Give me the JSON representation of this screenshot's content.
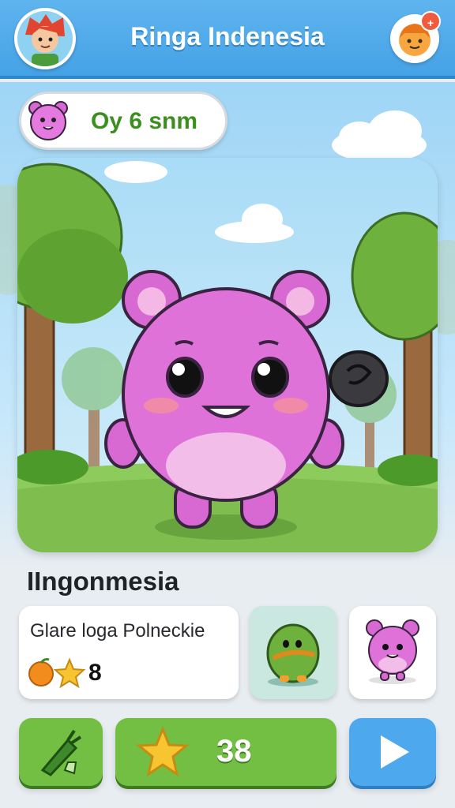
{
  "header": {
    "title": "Ringa Indenesia",
    "avatar_icon": "player-avatar-icon",
    "profile_icon": "profile-face-icon",
    "notification_badge": "+"
  },
  "speech": {
    "text": "Oy 6 snm",
    "icon": "pink-pet-icon"
  },
  "pet": {
    "name": "IIngonmesia",
    "color": "#d868d2"
  },
  "info_card": {
    "description": "Glare loga Polneckie",
    "icons": [
      "orange-fruit-icon",
      "star-icon"
    ],
    "count": "8"
  },
  "thumbnails": [
    {
      "icon": "green-creature-icon",
      "bg": "#cbe8e0"
    },
    {
      "icon": "pink-pet-icon",
      "bg": "#ffffff"
    }
  ],
  "bottom_bar": {
    "feed_icon": "carrot-icon",
    "score_icon": "star-icon",
    "score": "38",
    "next_icon": "play-arrow-icon"
  },
  "colors": {
    "header_blue": "#4aa6e8",
    "button_green": "#72bf44",
    "button_blue": "#4ea8ee",
    "pet_pink": "#d868d2"
  }
}
